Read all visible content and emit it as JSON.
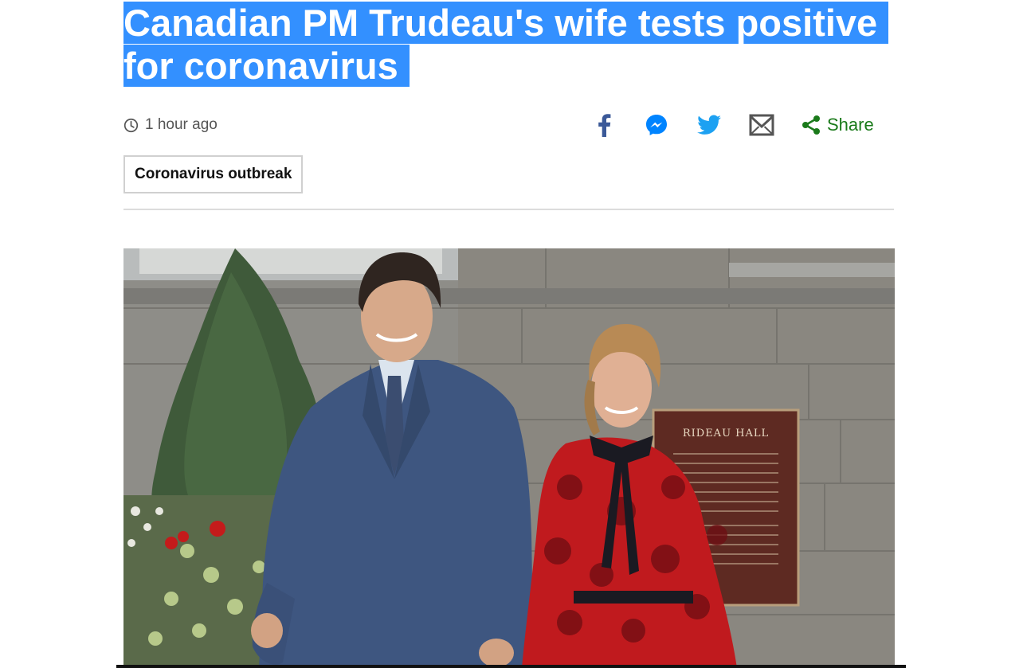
{
  "article": {
    "headline": "Canadian PM Trudeau's wife tests positive for coronavirus",
    "timestamp": "1 hour ago",
    "tag": "Coronavirus outbreak"
  },
  "share": {
    "label": "Share",
    "icons": [
      "facebook-icon",
      "messenger-icon",
      "twitter-icon",
      "email-icon",
      "share-icon"
    ]
  },
  "photo": {
    "plaque_text": "RIDEAU HALL"
  },
  "colors": {
    "selection": "#3390ff",
    "facebook": "#3b5998",
    "messenger": "#0084ff",
    "twitter": "#1da1f2",
    "email": "#555555",
    "share": "#1a7a1a"
  }
}
